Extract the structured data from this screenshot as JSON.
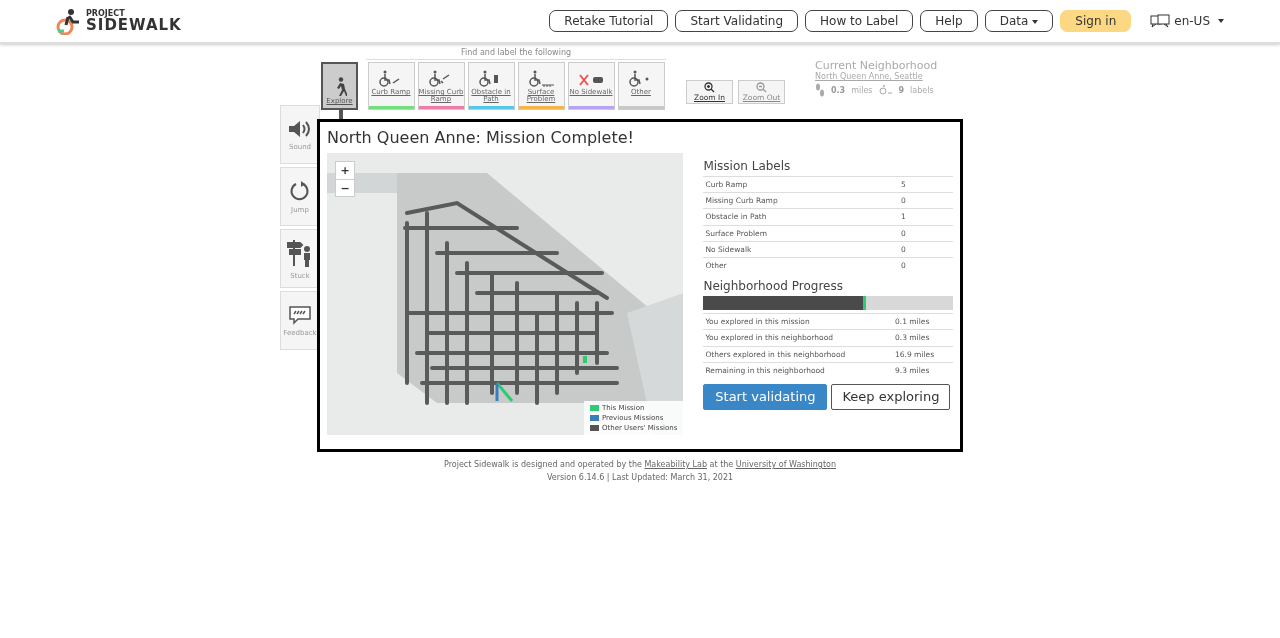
{
  "header": {
    "logo_small": "PROJECT",
    "logo_big": "SIDEWALK",
    "nav": [
      {
        "label": "Retake Tutorial",
        "kind": "plain"
      },
      {
        "label": "Start Validating",
        "kind": "plain"
      },
      {
        "label": "How to Label",
        "kind": "plain"
      },
      {
        "label": "Help",
        "kind": "plain"
      },
      {
        "label": "Data",
        "kind": "dropdown"
      },
      {
        "label": "Sign in",
        "kind": "primary"
      }
    ],
    "language": "en-US"
  },
  "toolbar": {
    "heading": "Find and label the following",
    "explore": {
      "label": "Explore",
      "selected": true
    },
    "label_types": [
      {
        "label": "Curb Ramp",
        "color": "#6fe07a",
        "selected": false
      },
      {
        "label": "Missing Curb Ramp",
        "color": "#f07aa8",
        "selected": false
      },
      {
        "label": "Obstacle in Path",
        "color": "#56c8e6",
        "selected": false
      },
      {
        "label": "Surface Problem",
        "color": "#f5b54a",
        "selected": false
      },
      {
        "label": "No Sidewalk",
        "color": "#b9a3f0",
        "selected": false
      },
      {
        "label": "Other",
        "color": "#c8c8c8",
        "selected": false
      }
    ],
    "zoom": [
      {
        "label": "Zoom In",
        "disabled": false
      },
      {
        "label": "Zoom Out",
        "disabled": true
      }
    ]
  },
  "neighborhood": {
    "title": "Current Neighborhood",
    "name": "North Queen Anne, Seattle",
    "distance": "0.3",
    "distance_unit": "miles",
    "labels": "9",
    "labels_unit": "labels"
  },
  "side_buttons": [
    {
      "label": "Sound",
      "kind": "sound"
    },
    {
      "label": "Jump",
      "kind": "jump"
    },
    {
      "label": "Stuck",
      "kind": "stuck"
    },
    {
      "label": "Feedback",
      "kind": "feedback"
    }
  ],
  "modal": {
    "title": "North Queen Anne: Mission Complete!",
    "map": {
      "zoom_in": "+",
      "zoom_out": "−",
      "legend": [
        {
          "label": "This Mission",
          "color": "#2ecc71"
        },
        {
          "label": "Previous Missions",
          "color": "#3a7dbf"
        },
        {
          "label": "Other Users' Missions",
          "color": "#555555"
        }
      ]
    },
    "mission_labels": {
      "title": "Mission Labels",
      "rows": [
        {
          "name": "Curb Ramp",
          "count": "5"
        },
        {
          "name": "Missing Curb Ramp",
          "count": "0"
        },
        {
          "name": "Obstacle in Path",
          "count": "1"
        },
        {
          "name": "Surface Problem",
          "count": "0"
        },
        {
          "name": "No Sidewalk",
          "count": "0"
        },
        {
          "name": "Other",
          "count": "0"
        }
      ]
    },
    "progress": {
      "title": "Neighborhood Progress",
      "level": 0.65,
      "rows": [
        {
          "name": "You explored in this mission",
          "value": "0.1 miles"
        },
        {
          "name": "You explored in this neighborhood",
          "value": "0.3 miles"
        },
        {
          "name": "Others explored in this neighborhood",
          "value": "16.9 miles"
        },
        {
          "name": "Remaining in this neighborhood",
          "value": "9.3 miles"
        }
      ]
    },
    "buttons": [
      {
        "label": "Start validating",
        "kind": "primary"
      },
      {
        "label": "Keep exploring",
        "kind": "secondary"
      }
    ]
  },
  "footer": {
    "line1": [
      {
        "text": "Project Sidewalk is designed and operated by the",
        "kind": "text"
      },
      {
        "text": "Makeability Lab",
        "kind": "link"
      },
      {
        "text": "at the",
        "kind": "text"
      },
      {
        "text": "University of Washington",
        "kind": "link"
      }
    ],
    "line2": "Version 6.14.6 | Last Updated: March 31, 2021"
  }
}
